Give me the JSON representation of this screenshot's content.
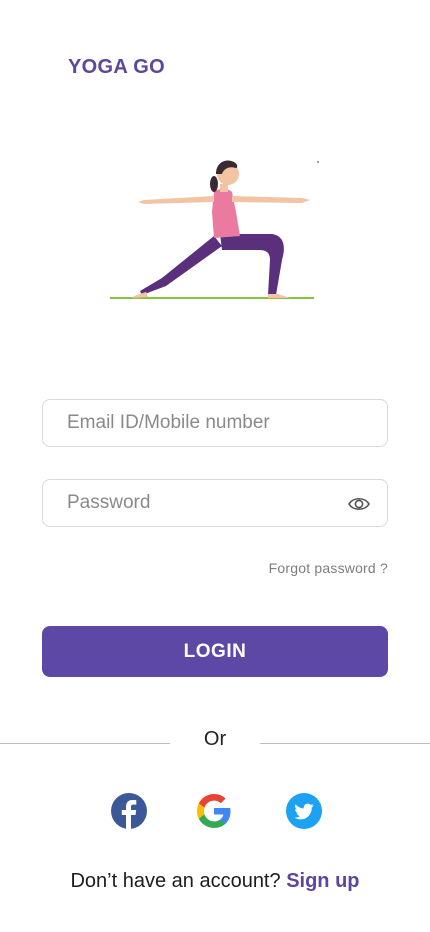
{
  "app": {
    "brand": "YOGA GO"
  },
  "login_form": {
    "email_placeholder": "Email ID/Mobile number",
    "password_placeholder": "Password",
    "forgot_password": "Forgot password ?",
    "login_label": "LOGIN"
  },
  "divider": {
    "label": "Or"
  },
  "social": {
    "providers": [
      "facebook-icon",
      "google-icon",
      "twitter-icon"
    ]
  },
  "signup": {
    "prompt": "Don’t have an account?",
    "link": "Sign up"
  },
  "colors": {
    "brand": "#5b46a1",
    "button": "#5e48a6",
    "facebook": "#3b5998",
    "twitter": "#1da1f2"
  }
}
